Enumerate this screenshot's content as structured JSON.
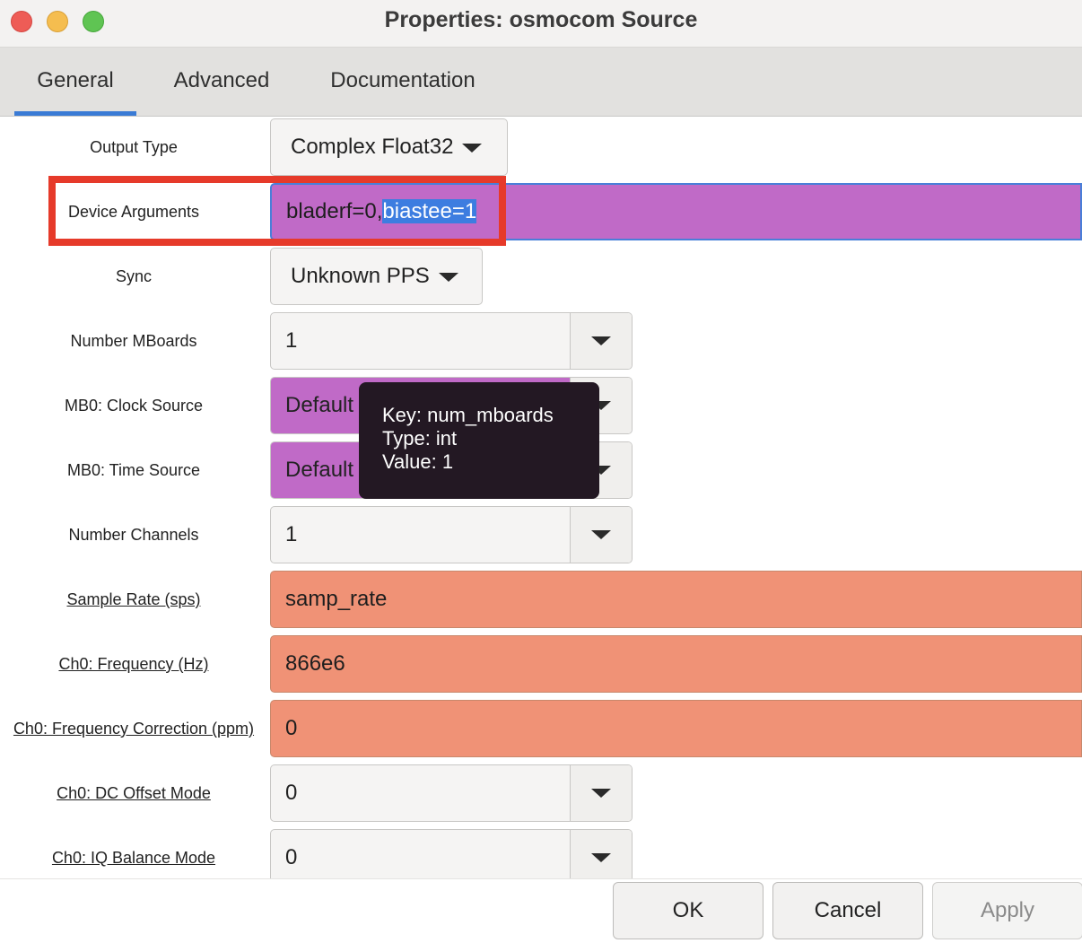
{
  "window": {
    "title": "Properties: osmocom Source"
  },
  "tabs": [
    {
      "label": "General",
      "active": true
    },
    {
      "label": "Advanced",
      "active": false
    },
    {
      "label": "Documentation",
      "active": false
    }
  ],
  "fields": {
    "output_type": {
      "label": "Output Type",
      "value": "Complex Float32"
    },
    "device_arguments": {
      "label": "Device Arguments",
      "value_plain": "bladerf=0,",
      "value_selected": "biastee=1"
    },
    "sync": {
      "label": "Sync",
      "value": "Unknown PPS"
    },
    "num_mboards": {
      "label": "Number MBoards",
      "value": "1"
    },
    "mb0_clock_source": {
      "label": "MB0: Clock Source",
      "value": "Default"
    },
    "mb0_time_source": {
      "label": "MB0: Time Source",
      "value": "Default"
    },
    "num_channels": {
      "label": "Number Channels",
      "value": "1"
    },
    "sample_rate": {
      "label": "Sample Rate (sps)",
      "value": "samp_rate"
    },
    "ch0_freq": {
      "label": "Ch0: Frequency (Hz)",
      "value": "866e6"
    },
    "ch0_freq_corr": {
      "label": "Ch0: Frequency Correction (ppm)",
      "value": "0"
    },
    "ch0_dc_offset": {
      "label": "Ch0: DC Offset Mode",
      "value": "0"
    },
    "ch0_iq_balance": {
      "label": "Ch0: IQ Balance Mode",
      "value": "0"
    }
  },
  "tooltip": {
    "key": "Key: num_mboards",
    "type": "Type: int",
    "value": "Value: 1"
  },
  "buttons": {
    "ok": "OK",
    "cancel": "Cancel",
    "apply": "Apply"
  },
  "colors": {
    "purple_field": "#c06ac7",
    "salmon_field": "#f09276",
    "highlight_box": "#e63a2a",
    "tab_underline": "#3a7bd5",
    "selection": "#3d7de0"
  }
}
